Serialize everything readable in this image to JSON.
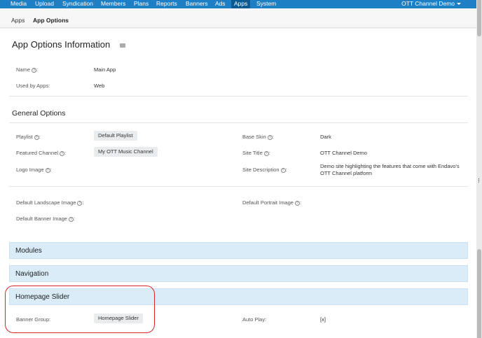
{
  "nav": {
    "items": [
      "Media",
      "Upload",
      "Syndication",
      "Members",
      "Plans",
      "Reports",
      "Banners",
      "Ads",
      "Apps",
      "System"
    ],
    "active": "Apps",
    "account": "OTT Channel Demo",
    "accent": "#1f7fc4"
  },
  "breadcrumb": {
    "parent": "Apps",
    "current": "App Options"
  },
  "info": {
    "title": "App Options Information",
    "name_label": "Name",
    "name_value": "Main App",
    "used_label": "Used by Apps:",
    "used_value": "Web"
  },
  "general": {
    "title": "General Options",
    "playlist_label": "Playlist",
    "playlist_value": "Default Playlist",
    "featured_label": "Featured Channel",
    "featured_value": "My OTT Music Channel",
    "logo_label": "Logo Image",
    "base_skin_label": "Base Skin",
    "base_skin_value": "Dark",
    "site_title_label": "Site Title",
    "site_title_value": "OTT Channel Demo",
    "site_desc_label": "Site Description",
    "site_desc_value": "Demo site highlighting the features that come with Endavo's OTT Channel platform",
    "landscape_label": "Default Landscape Image",
    "portrait_label": "Default Portrait Image",
    "banner_label": "Default Banner Image"
  },
  "sections": {
    "modules": "Modules",
    "navigation": "Navigation",
    "homepage_slider": "Homepage Slider"
  },
  "slider": {
    "banner_group_label": "Banner Group:",
    "banner_group_value": "Homepage Slider",
    "autoplay_label": "Auto Play:",
    "autoplay_value": "[x]"
  },
  "highlight_color": "#d9252a"
}
